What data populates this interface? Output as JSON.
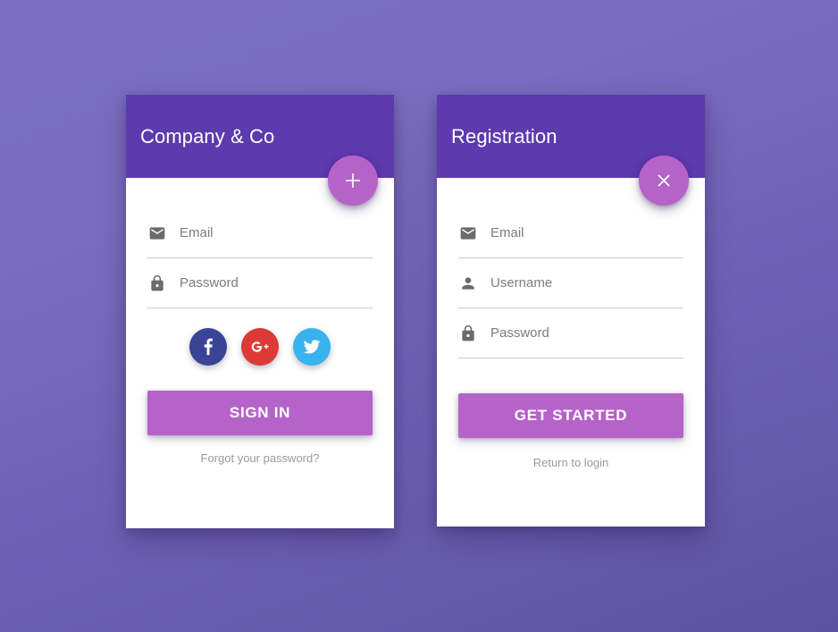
{
  "theme": {
    "background_top": "#7b6ec0",
    "background_bottom": "#5d53a0",
    "header_purple": "#5d3aae",
    "accent_pink": "#b663c9",
    "card_white": "#ffffff",
    "field_line": "#c9c9c9",
    "muted_text": "#9a9a9a",
    "icon_gray": "#6b6b6b"
  },
  "login_card": {
    "title": "Company & Co",
    "fab": {
      "icon": "plus-icon",
      "label": "+",
      "color": "#b663c9"
    },
    "fields": [
      {
        "icon": "envelope-icon",
        "placeholder": "Email",
        "value": "",
        "type": "email"
      },
      {
        "icon": "lock-icon",
        "placeholder": "Password",
        "value": "",
        "type": "password"
      }
    ],
    "social": [
      {
        "name": "facebook",
        "icon": "facebook-icon",
        "label": "f",
        "color": "#3b4397"
      },
      {
        "name": "google-plus",
        "icon": "google-plus-icon",
        "label": "G+",
        "color": "#dc3a36"
      },
      {
        "name": "twitter",
        "icon": "twitter-icon",
        "label": "twitter",
        "color": "#38b3ef"
      }
    ],
    "submit_label": "SIGN IN",
    "footer_link": "Forgot your password?"
  },
  "registration_card": {
    "title": "Registration",
    "fab": {
      "icon": "close-icon",
      "label": "×",
      "color": "#b663c9"
    },
    "fields": [
      {
        "icon": "envelope-icon",
        "placeholder": "Email",
        "value": "",
        "type": "email"
      },
      {
        "icon": "person-icon",
        "placeholder": "Username",
        "value": "",
        "type": "text"
      },
      {
        "icon": "lock-icon",
        "placeholder": "Password",
        "value": "",
        "type": "password"
      }
    ],
    "submit_label": "GET STARTED",
    "footer_link": "Return to login"
  }
}
